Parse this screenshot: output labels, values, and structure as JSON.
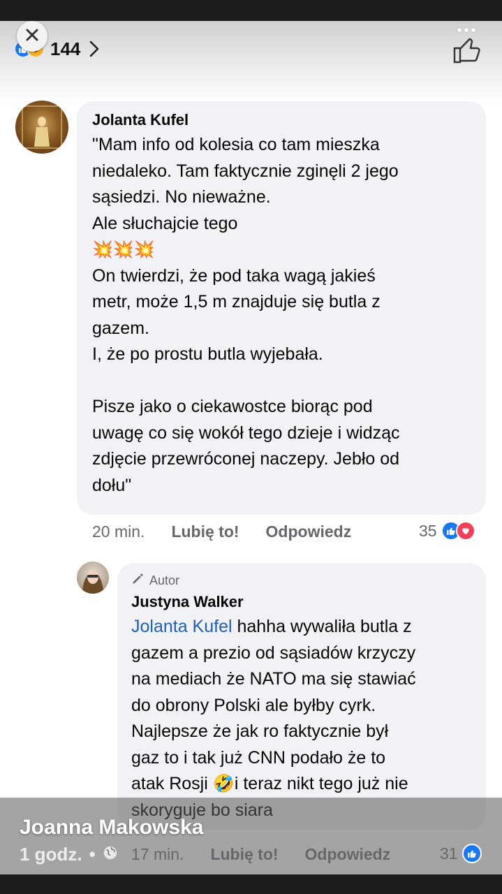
{
  "header": {
    "reaction_count": "144",
    "reaction_icons": [
      "like-icon",
      "haha-icon"
    ]
  },
  "comment1": {
    "author": "Jolanta Kufel",
    "text_part1": "\"Mam info od kolesia co tam mieszka\nniedaleko. Tam faktycznie zginęli 2 jego\nsąsiedzi. No nieważne.\nAle słuchajcie tego",
    "emoji": "💥💥💥",
    "text_part2": "On twierdzi, że pod taka wagą jakieś\nmetr, może 1,5 m znajduje się butla z\ngazem.\nI, że po prostu butla wyjebała.\n\nPisze jako o ciekawostce biorąc pod\nuwagę co się wokół tego dzieje i widząc\nzdjęcie przewróconej naczepy. Jebło od\ndołu\"",
    "time": "20 min.",
    "like_label": "Lubię to!",
    "reply_label": "Odpowiedz",
    "reaction_count": "35"
  },
  "comment2": {
    "badge": "Autor",
    "author": "Justyna Walker",
    "mention": "Jolanta Kufel",
    "text_part1": " hahha wywaliła butla z\ngazem a prezio od sąsiadów krzyczy\nna mediach że NATO ma się stawiać\ndo obrony Polski ale byłby cyrk.\nNajlepsze że jak ro faktycznie był\ngaz to i tak już CNN podało że to\natak Rosji ",
    "emoji": "🤣",
    "text_part2": "i teraz nikt tego już nie\nskoryguje bo siara",
    "time": "17 min.",
    "like_label": "Lubię to!",
    "reply_label": "Odpowiedz",
    "reaction_count": "31"
  },
  "story": {
    "name": "Joanna Makowska",
    "time": "1 godz.",
    "separator": "•"
  },
  "colors": {
    "like_blue": "#1877f2",
    "love_red": "#f33e58",
    "mention_blue": "#1e5fb7",
    "bubble_bg": "#f0f2f5"
  }
}
